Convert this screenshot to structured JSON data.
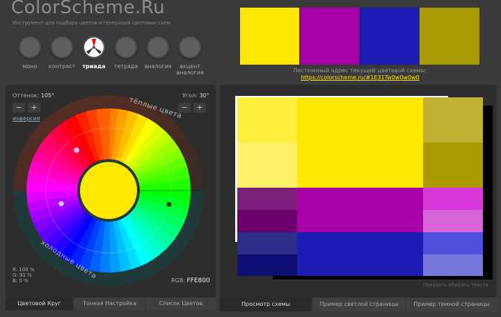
{
  "header": {
    "logo": "ColorScheme.Ru",
    "tagline": "Инструмент для подбора цветов и генерация цветовых схем"
  },
  "modes": [
    {
      "label": "моно",
      "active": false
    },
    {
      "label": "контраст",
      "active": false
    },
    {
      "label": "триада",
      "active": true
    },
    {
      "label": "тетрада",
      "active": false
    },
    {
      "label": "аналогия",
      "active": false
    },
    {
      "label": "акцент\nаналогия",
      "active": false
    }
  ],
  "palette": {
    "swatches": [
      "#ffe800",
      "#a800a8",
      "#1c1cb4",
      "#a89a00"
    ],
    "url_label": "Постоянный адрес текущей цветовой схемы:",
    "url": "https://colorscheme.ru/#1E31Tw0w0w0w0"
  },
  "wheel": {
    "hue_label": "Оттенок:",
    "hue_value": "105°",
    "angle_label": "Угол:",
    "angle_value": "30°",
    "minus": "−",
    "plus": "+",
    "invert_link": "инверсия",
    "warm_label": "тёплые цвета",
    "cold_label": "холодные цвета",
    "r_label": "R:",
    "r_value": "100 %",
    "g_label": "G:",
    "g_value": "91 %",
    "b_label": "B:",
    "b_value": "0 %",
    "rgb_label": "RGB:",
    "rgb_value": "FFE800",
    "center_color": "#ffe800"
  },
  "preview": {
    "colors": {
      "primary": "#ffe800",
      "primary_light1": "#ffee3a",
      "primary_light2": "#fff06a",
      "secondary_a": "#a800a8",
      "secondary_a_dark1": "#7a1e7a",
      "secondary_a_dark2": "#6c006c",
      "secondary_a_light1": "#d838d8",
      "secondary_a_light2": "#d866d8",
      "secondary_b": "#1c1cb4",
      "secondary_b_dark1": "#2e2e8a",
      "secondary_b_dark2": "#0e0e74",
      "secondary_b_light1": "#5050dc",
      "secondary_b_light2": "#7878dc",
      "complement": "#a89a00",
      "complement_light": "#c0b232"
    },
    "sample_text_link": "Показать образец текста"
  },
  "left_tabs": [
    {
      "label": "Цветовой Круг",
      "active": true
    },
    {
      "label": "Тонкая Настройка",
      "active": false
    },
    {
      "label": "Список Цветов",
      "active": false
    }
  ],
  "right_tabs": [
    {
      "label": "Просмотр схемы",
      "active": true
    },
    {
      "label": "Пример светлой страницы",
      "active": false
    },
    {
      "label": "Пример темной страницы",
      "active": false
    }
  ]
}
